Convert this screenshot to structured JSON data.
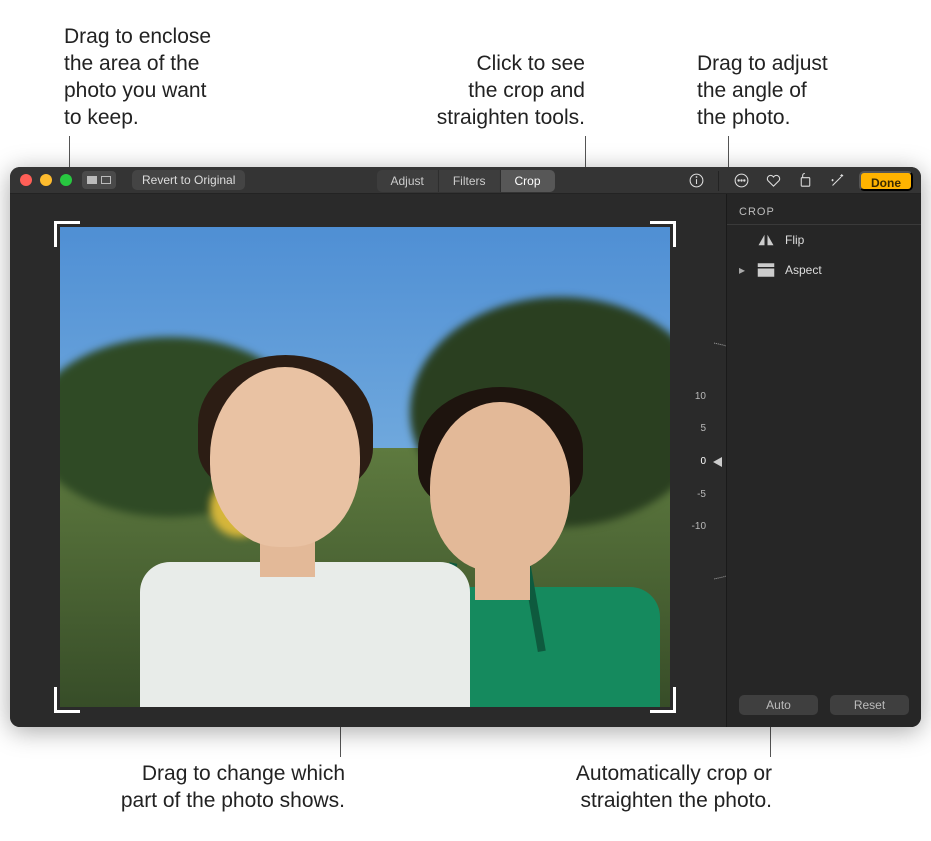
{
  "callouts": {
    "top_left": "Drag to enclose\nthe area of the\nphoto you want\nto keep.",
    "top_mid": "Click to see\nthe crop and\nstraighten tools.",
    "top_right": "Drag to adjust\nthe angle of\nthe photo.",
    "bot_left": "Drag to change which\npart of the photo shows.",
    "bot_right": "Automatically crop or\nstraighten the photo."
  },
  "toolbar": {
    "revert_label": "Revert to Original",
    "tabs": {
      "adjust": "Adjust",
      "filters": "Filters",
      "crop": "Crop"
    },
    "active_tab": "crop",
    "done_label": "Done"
  },
  "dial": {
    "labels": {
      "p10": "10",
      "p5": "5",
      "zero": "0",
      "m5": "-5",
      "m10": "-10"
    },
    "value_deg": 0
  },
  "side": {
    "title": "CROP",
    "flip_label": "Flip",
    "aspect_label": "Aspect",
    "auto_label": "Auto",
    "reset_label": "Reset"
  },
  "colors": {
    "window_bg": "#2a2a2a",
    "toolbar_bg": "#343434",
    "accent_done": "#ffb300"
  }
}
